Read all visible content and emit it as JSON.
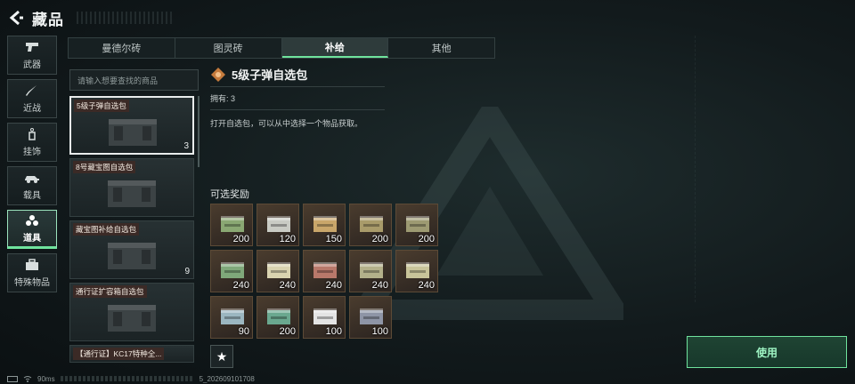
{
  "header": {
    "title": "藏品"
  },
  "rail": [
    {
      "label": "武器",
      "icon": "pistol-icon",
      "active": false
    },
    {
      "label": "近战",
      "icon": "knife-icon",
      "active": false
    },
    {
      "label": "挂饰",
      "icon": "charm-icon",
      "active": false
    },
    {
      "label": "载具",
      "icon": "vehicle-icon",
      "active": false
    },
    {
      "label": "道具",
      "icon": "items-icon",
      "active": true
    },
    {
      "label": "特殊物品",
      "icon": "toolbox-icon",
      "active": false
    }
  ],
  "tabs": [
    {
      "label": "曼德尔砖",
      "active": false
    },
    {
      "label": "图灵砖",
      "active": false
    },
    {
      "label": "补给",
      "active": true
    },
    {
      "label": "其他",
      "active": false
    }
  ],
  "search": {
    "placeholder": "请输入想要查找的商品"
  },
  "list": [
    {
      "name": "5级子弹自选包",
      "count": "3",
      "selected": true
    },
    {
      "name": "8号藏宝图自选包",
      "count": "",
      "selected": false
    },
    {
      "name": "藏宝图补给自选包",
      "count": "9",
      "selected": false
    },
    {
      "name": "通行证扩容箱自选包",
      "count": "",
      "selected": false
    },
    {
      "name": "【通行证】KC17特种全...",
      "count": "",
      "selected": false
    }
  ],
  "detail": {
    "title": "5级子弹自选包",
    "owned": "拥有: 3",
    "description": "打开自选包，可以从中选择一个物品获取。"
  },
  "rewards": {
    "label": "可选奖励",
    "items": [
      {
        "qty": "200",
        "color": "#8aa873"
      },
      {
        "qty": "120",
        "color": "#c9cbc4"
      },
      {
        "qty": "150",
        "color": "#c9a66a"
      },
      {
        "qty": "200",
        "color": "#a99b6a"
      },
      {
        "qty": "200",
        "color": "#9d9a72"
      },
      {
        "qty": "240",
        "color": "#7fa87a"
      },
      {
        "qty": "240",
        "color": "#d9d3b0"
      },
      {
        "qty": "240",
        "color": "#b8786a"
      },
      {
        "qty": "240",
        "color": "#b3b08a"
      },
      {
        "qty": "240",
        "color": "#c8c49a"
      },
      {
        "qty": "90",
        "color": "#9bb6c0"
      },
      {
        "qty": "200",
        "color": "#6aa88f"
      },
      {
        "qty": "100",
        "color": "#e4e4e4"
      },
      {
        "qty": "100",
        "color": "#8e95a6"
      }
    ]
  },
  "actions": {
    "use_label": "使用",
    "favorite_icon": "star-icon"
  },
  "status": {
    "ping": "90ms",
    "build": "5_202609101708"
  }
}
